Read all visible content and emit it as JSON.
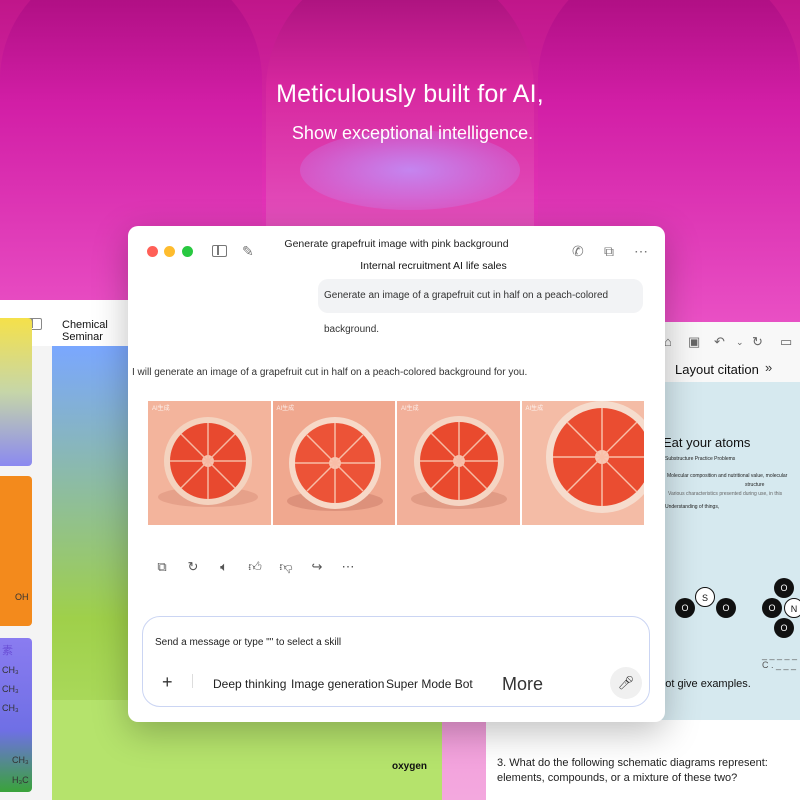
{
  "hero": {
    "headline": "Meticulously built for AI,",
    "subline": "Show exceptional intelligence."
  },
  "left_panel": {
    "title": "Chemical Seminar",
    "tile_texts": [
      "OH",
      "素",
      "CH₃",
      "CH₃",
      "CH₃",
      "CH₃",
      "H₃C"
    ]
  },
  "right_panel": {
    "title": "Layout citation",
    "chevrons": "»",
    "doc_heading": "Eat your atoms",
    "doc_lines": [
      "Substructure Practice Problems",
      "Molecular composition and nutritional value, molecular",
      "structure",
      "Various characteristics presented during use, in this",
      "Understanding of things,"
    ],
    "atoms": [
      "O",
      "S",
      "O",
      "O",
      "O",
      "N",
      "O"
    ],
    "dash_c": "_ _ _ _ _ C . _ _ _",
    "no_examples": "Do not give examples.",
    "question": "3. What do the following schematic diagrams represent: elements, compounds, or a mixture of these two?"
  },
  "bottom": {
    "oxygen_label": "oxygen"
  },
  "chat": {
    "title": "Generate grapefruit image with pink background",
    "subtitle": "Internal recruitment AI life sales",
    "user_message": "Generate an image of a grapefruit cut in half on a peach-colored background.",
    "assistant_message": "I will generate an image of a grapefruit cut in half on a peach-colored background for you.",
    "images": [
      {
        "label": "AI生成"
      },
      {
        "label": "AI生成"
      },
      {
        "label": "AI生成"
      },
      {
        "label": "AI生成"
      }
    ],
    "composer": {
      "placeholder": "Send a message or type \"\" to select a skill",
      "chips": [
        "Deep thinking",
        "Image generation",
        "Super Mode Bot",
        "More"
      ]
    }
  },
  "icons": {
    "phone": "phone-icon",
    "window": "window-icon",
    "more": "more-icon",
    "copy": "copy-icon",
    "regenerate": "refresh-icon",
    "speaker": "speaker-icon",
    "thumbs_up": "thumbs-up-icon",
    "thumbs_down": "thumbs-down-icon",
    "share": "share-icon",
    "mic": "microphone-icon"
  },
  "colors": {
    "background_top": "#c0168a",
    "background_bottom": "#f3a8de",
    "composer_border": "#cbd5f3",
    "grapefruit_bg": "#f3b49c"
  }
}
